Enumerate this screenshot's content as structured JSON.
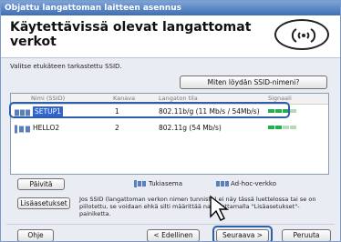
{
  "window": {
    "title": "Objattu langattoman laitteen asennus"
  },
  "header": {
    "title": "Käytettävissä olevat langattomat verkot"
  },
  "instruction": "Valitse etukäteen tarkastettu SSID.",
  "help_ssid_button": "Miten löydän SSID-nimeni?",
  "list": {
    "columns": [
      "Nimi (SSID)",
      "Kanava",
      "Langaton tila",
      "Signaali"
    ],
    "rows": [
      {
        "ssid": "SETUP1",
        "channel": "1",
        "mode": "802.11b/g (11 Mb/s / 54Mb/s)",
        "signal_bars": 3,
        "signal_max": 4,
        "selected": true,
        "icon": "adhoc-network-icon"
      },
      {
        "ssid": "HELLO2",
        "channel": "2",
        "mode": "802.11g (54 Mb/s)",
        "signal_bars": 2,
        "signal_max": 4,
        "selected": false,
        "icon": "access-point-icon"
      }
    ]
  },
  "refresh_button": "Päivitä",
  "legend": {
    "access_point": "Tukiasema",
    "adhoc": "Ad-hoc-verkko"
  },
  "advanced_button": "Lisäasetukset",
  "note": "Jos SSID (langattoman verkon nimen tunniste) ei näy tässä luettelossa tai se on piilotettu, se voidaan ehkä silti määrittää napsauttamalla \"Lisäasetukset\"-painiketta.",
  "footer": {
    "help": "Ohje",
    "back": "< Edellinen",
    "next": "Seuraava >",
    "cancel": "Peruuta"
  },
  "colors": {
    "titlebar": "#3e6fb4",
    "selection": "#3366cc",
    "outline": "#2b5fae",
    "signal": "#22b14c"
  }
}
